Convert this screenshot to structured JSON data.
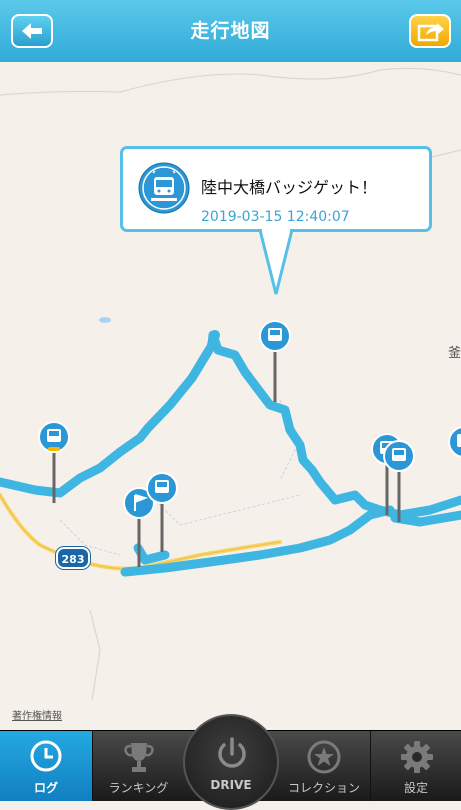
{
  "header": {
    "title": "走行地図",
    "back_button": "back-arrow-icon",
    "share_button": "share-icon"
  },
  "popup": {
    "title": "陸中大橋バッジゲット！",
    "timestamp": "2019-03-15 12:40:07",
    "icon": "train-badge-icon"
  },
  "map": {
    "route_number": "283",
    "copyright_label": "著作権情報",
    "edge_label": "釜"
  },
  "tabbar": {
    "tabs": [
      {
        "label": "ログ",
        "icon": "clock-icon",
        "selected": true
      },
      {
        "label": "ランキング",
        "icon": "trophy-icon",
        "selected": false
      },
      {
        "label": "DRIVE",
        "icon": "power-icon",
        "selected": false
      },
      {
        "label": "コレクション",
        "icon": "star-icon",
        "selected": false
      },
      {
        "label": "設定",
        "icon": "gear-icon",
        "selected": false
      }
    ]
  },
  "colors": {
    "header": "#3fb6e2",
    "route": "#3fb6e2",
    "share_button": "#f5b800",
    "selected_tab": "#1a94d4",
    "map_background": "#f5f1ea"
  }
}
